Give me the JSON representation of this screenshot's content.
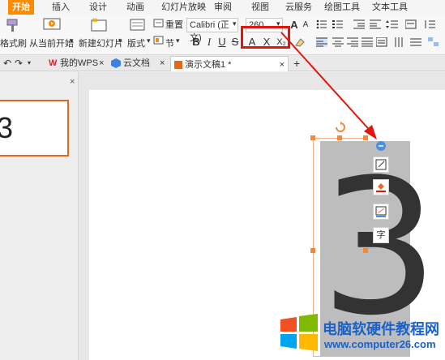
{
  "tabs": [
    "开始",
    "插入",
    "设计",
    "动画",
    "幻灯片放映",
    "审阅",
    "视图",
    "云服务",
    "绘图工具",
    "文本工具"
  ],
  "ribbon": {
    "format_painter": "格式刷",
    "from_current": "从当前开始",
    "new_slide": "新建幻灯片",
    "layout": "版式",
    "section": "节",
    "reset": "重置",
    "font_name": "Calibri (正文)",
    "font_size": "260",
    "bold": "B",
    "italic": "I",
    "underline": "U",
    "strike": "S",
    "font_color": "A",
    "clear": "X",
    "sub": "X₂"
  },
  "doc_tabs": {
    "my_wps": "我的WPS",
    "cloud_doc": "云文档",
    "presentation": "演示文稿1 *",
    "add": "+"
  },
  "slide": {
    "thumb_text": "3",
    "main_text": "3"
  },
  "watermark": {
    "title": "电脑软硬件教程网",
    "url": "www.computer26.com"
  },
  "colors": {
    "accent": "#ff8a00",
    "highlight": "#e2150e",
    "watermark": "#1a62c7"
  }
}
